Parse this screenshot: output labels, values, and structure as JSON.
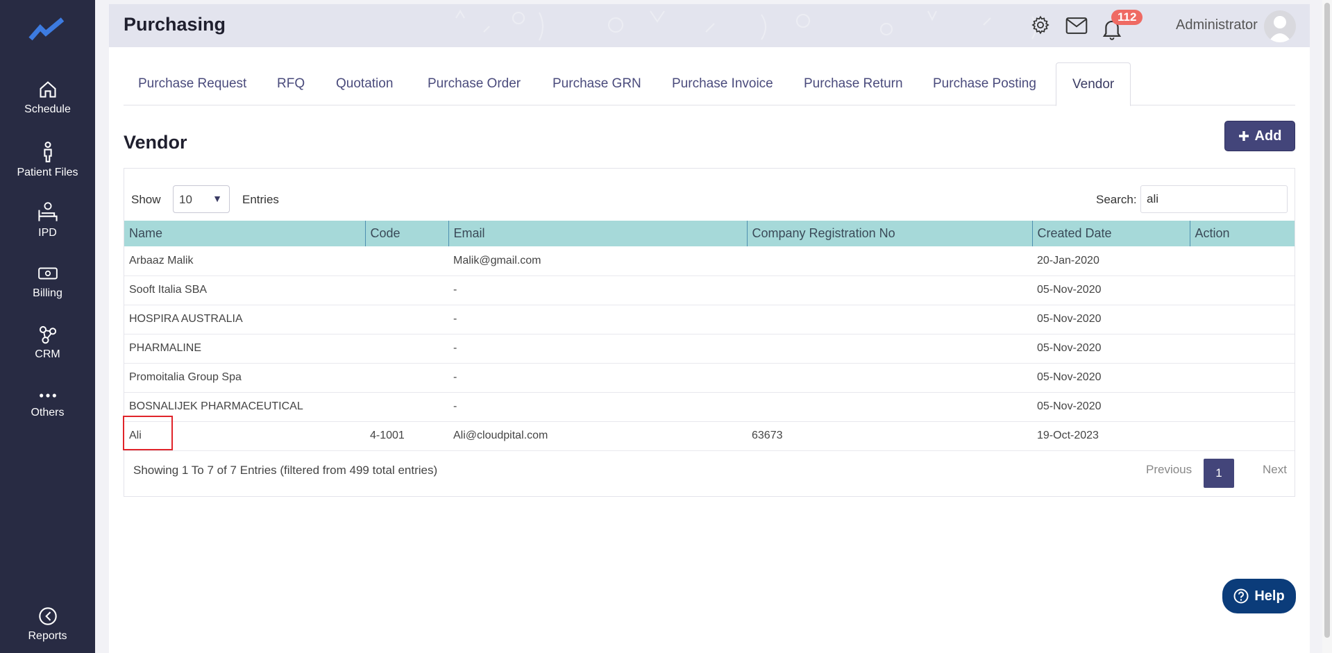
{
  "sidebar": {
    "items": [
      {
        "label": "Schedule",
        "icon": "home-icon"
      },
      {
        "label": "Patient Files",
        "icon": "person-icon"
      },
      {
        "label": "IPD",
        "icon": "bed-icon"
      },
      {
        "label": "Billing",
        "icon": "money-icon"
      },
      {
        "label": "CRM",
        "icon": "network-icon"
      },
      {
        "label": "Others",
        "icon": "more-icon"
      },
      {
        "label": "Reports",
        "icon": "gauge-icon"
      }
    ]
  },
  "header": {
    "title": "Purchasing",
    "notifications_count": "112",
    "user_name": "Administrator"
  },
  "tabs": [
    {
      "label": "Purchase Request"
    },
    {
      "label": "RFQ"
    },
    {
      "label": "Quotation"
    },
    {
      "label": "Purchase Order"
    },
    {
      "label": "Purchase GRN"
    },
    {
      "label": "Purchase Invoice"
    },
    {
      "label": "Purchase Return"
    },
    {
      "label": "Purchase Posting"
    },
    {
      "label": "Vendor"
    }
  ],
  "main": {
    "section_title": "Vendor",
    "add_label": "Add"
  },
  "table_controls": {
    "show_label": "Show",
    "entries_value": "10",
    "entries_label": "Entries",
    "search_label": "Search:",
    "search_value": "ali"
  },
  "table": {
    "columns": [
      "Name",
      "Code",
      "Email",
      "Company Registration No",
      "Created Date",
      "Action"
    ],
    "rows": [
      {
        "name": "Arbaaz Malik",
        "code": "",
        "email": "Malik@gmail.com",
        "reg": "",
        "date": "20-Jan-2020",
        "action": ""
      },
      {
        "name": "Sooft Italia SBA",
        "code": "",
        "email": "-",
        "reg": "",
        "date": "05-Nov-2020",
        "action": ""
      },
      {
        "name": "HOSPIRA AUSTRALIA",
        "code": "",
        "email": "-",
        "reg": "",
        "date": "05-Nov-2020",
        "action": ""
      },
      {
        "name": "PHARMALINE",
        "code": "",
        "email": "-",
        "reg": "",
        "date": "05-Nov-2020",
        "action": ""
      },
      {
        "name": "Promoitalia Group Spa",
        "code": "",
        "email": "-",
        "reg": "",
        "date": "05-Nov-2020",
        "action": ""
      },
      {
        "name": "BOSNALIJEK PHARMACEUTICAL",
        "code": "",
        "email": "-",
        "reg": "",
        "date": "05-Nov-2020",
        "action": ""
      },
      {
        "name": "Ali",
        "code": "4-1001",
        "email": "Ali@cloudpital.com",
        "reg": "63673",
        "date": "19-Oct-2023",
        "action": ""
      }
    ]
  },
  "footer": {
    "info": "Showing 1 To 7 of 7 Entries (filtered from 499 total entries)",
    "previous": "Previous",
    "page": "1",
    "next": "Next"
  },
  "help": {
    "label": "Help"
  },
  "colors": {
    "sidebar_bg": "#282b43",
    "accent": "#43457a",
    "table_header": "#a6d9d9",
    "badge": "#ef6a63",
    "help": "#0b3c7a",
    "highlight": "#e0242a"
  }
}
